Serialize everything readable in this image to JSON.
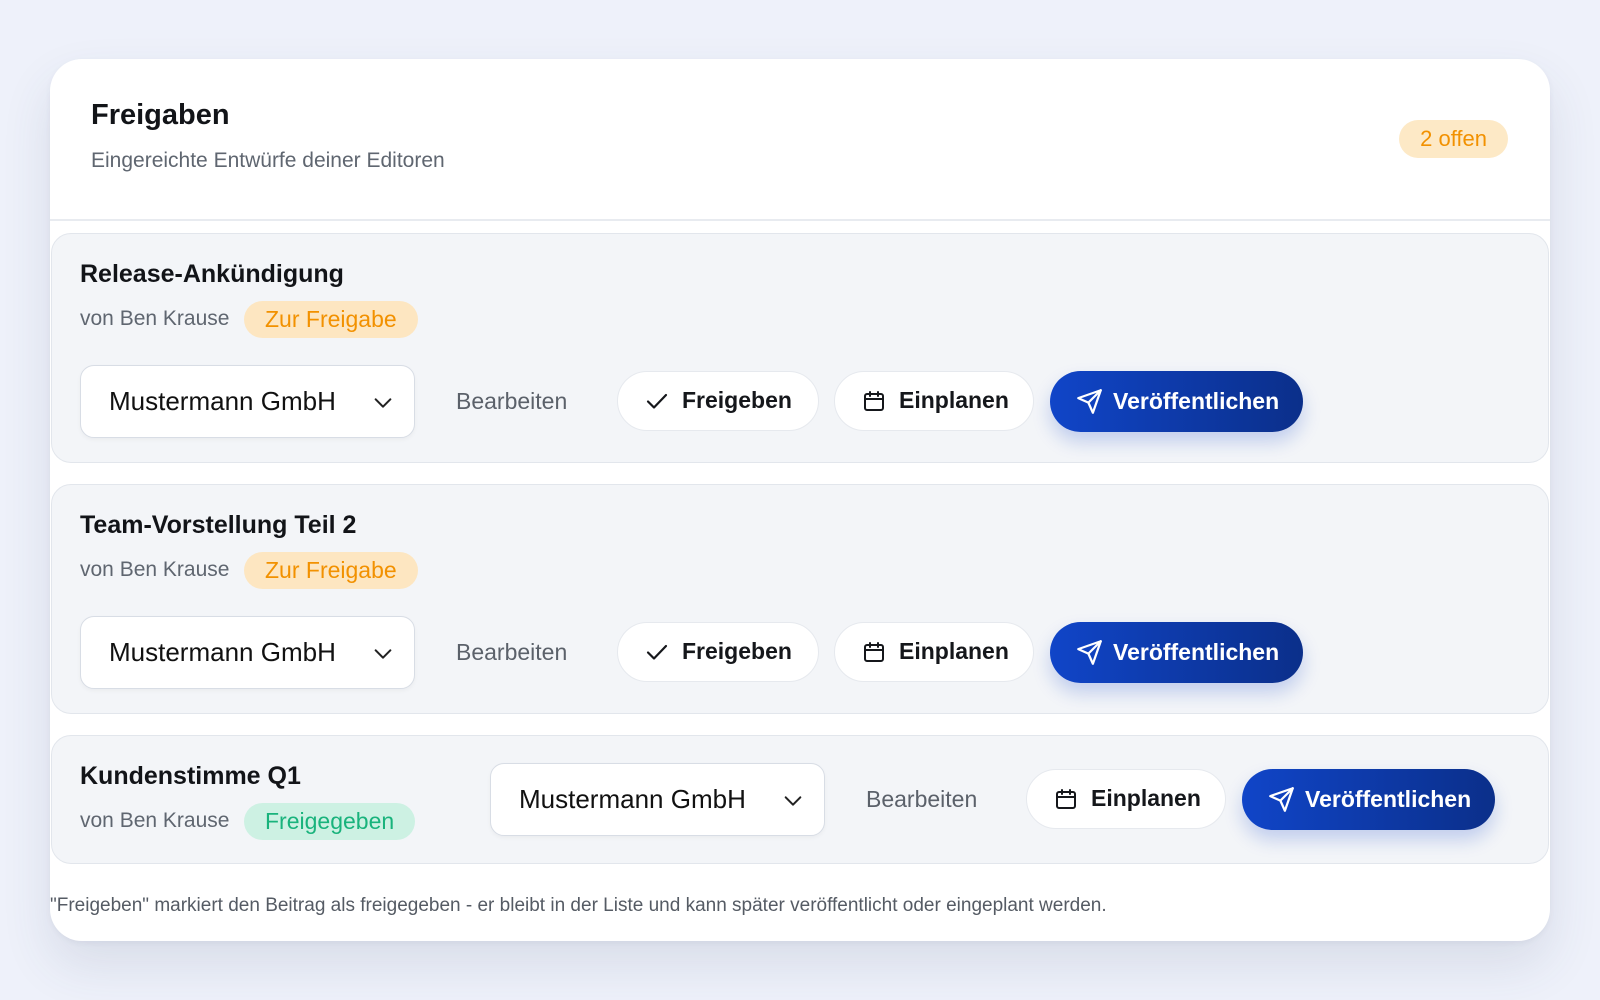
{
  "header": {
    "title": "Freigaben",
    "subtitle": "Eingereichte Entwürfe deiner Editoren",
    "open_count": "2 offen"
  },
  "submissions": [
    {
      "title": "Release-Ankündigung",
      "author": "von Ben Krause",
      "status": "Zur Freigabe",
      "account": "Mustermann GmbH",
      "actions": {
        "edit": "Bearbeiten",
        "approve": "Freigeben",
        "schedule": "Einplanen",
        "publish": "Veröffentlichen"
      }
    },
    {
      "title": "Team-Vorstellung Teil 2",
      "author": "von Ben Krause",
      "status": "Zur Freigabe",
      "account": "Mustermann GmbH",
      "actions": {
        "edit": "Bearbeiten",
        "approve": "Freigeben",
        "schedule": "Einplanen",
        "publish": "Veröffentlichen"
      }
    },
    {
      "title": "Kundenstimme Q1",
      "author": "von Ben Krause",
      "status": "Freigegeben",
      "account": "Mustermann GmbH",
      "actions": {
        "edit": "Bearbeiten",
        "schedule": "Einplanen",
        "publish": "Veröffentlichen"
      }
    }
  ],
  "footnote": "\"Freigeben\" markiert den Beitrag als freigegeben - er bleibt in der Liste und kann später veröffentlicht oder eingeplant werden.",
  "colors": {
    "accent": "#1045c8",
    "pending_badge_bg": "#fde6c1",
    "pending_badge_text": "#f29100",
    "approved_badge_bg": "#cdf1e3",
    "approved_badge_text": "#19b37c"
  },
  "icons": {
    "approve": "check-icon",
    "schedule": "calendar-icon",
    "publish": "send-icon",
    "select": "chevron-down-icon"
  }
}
